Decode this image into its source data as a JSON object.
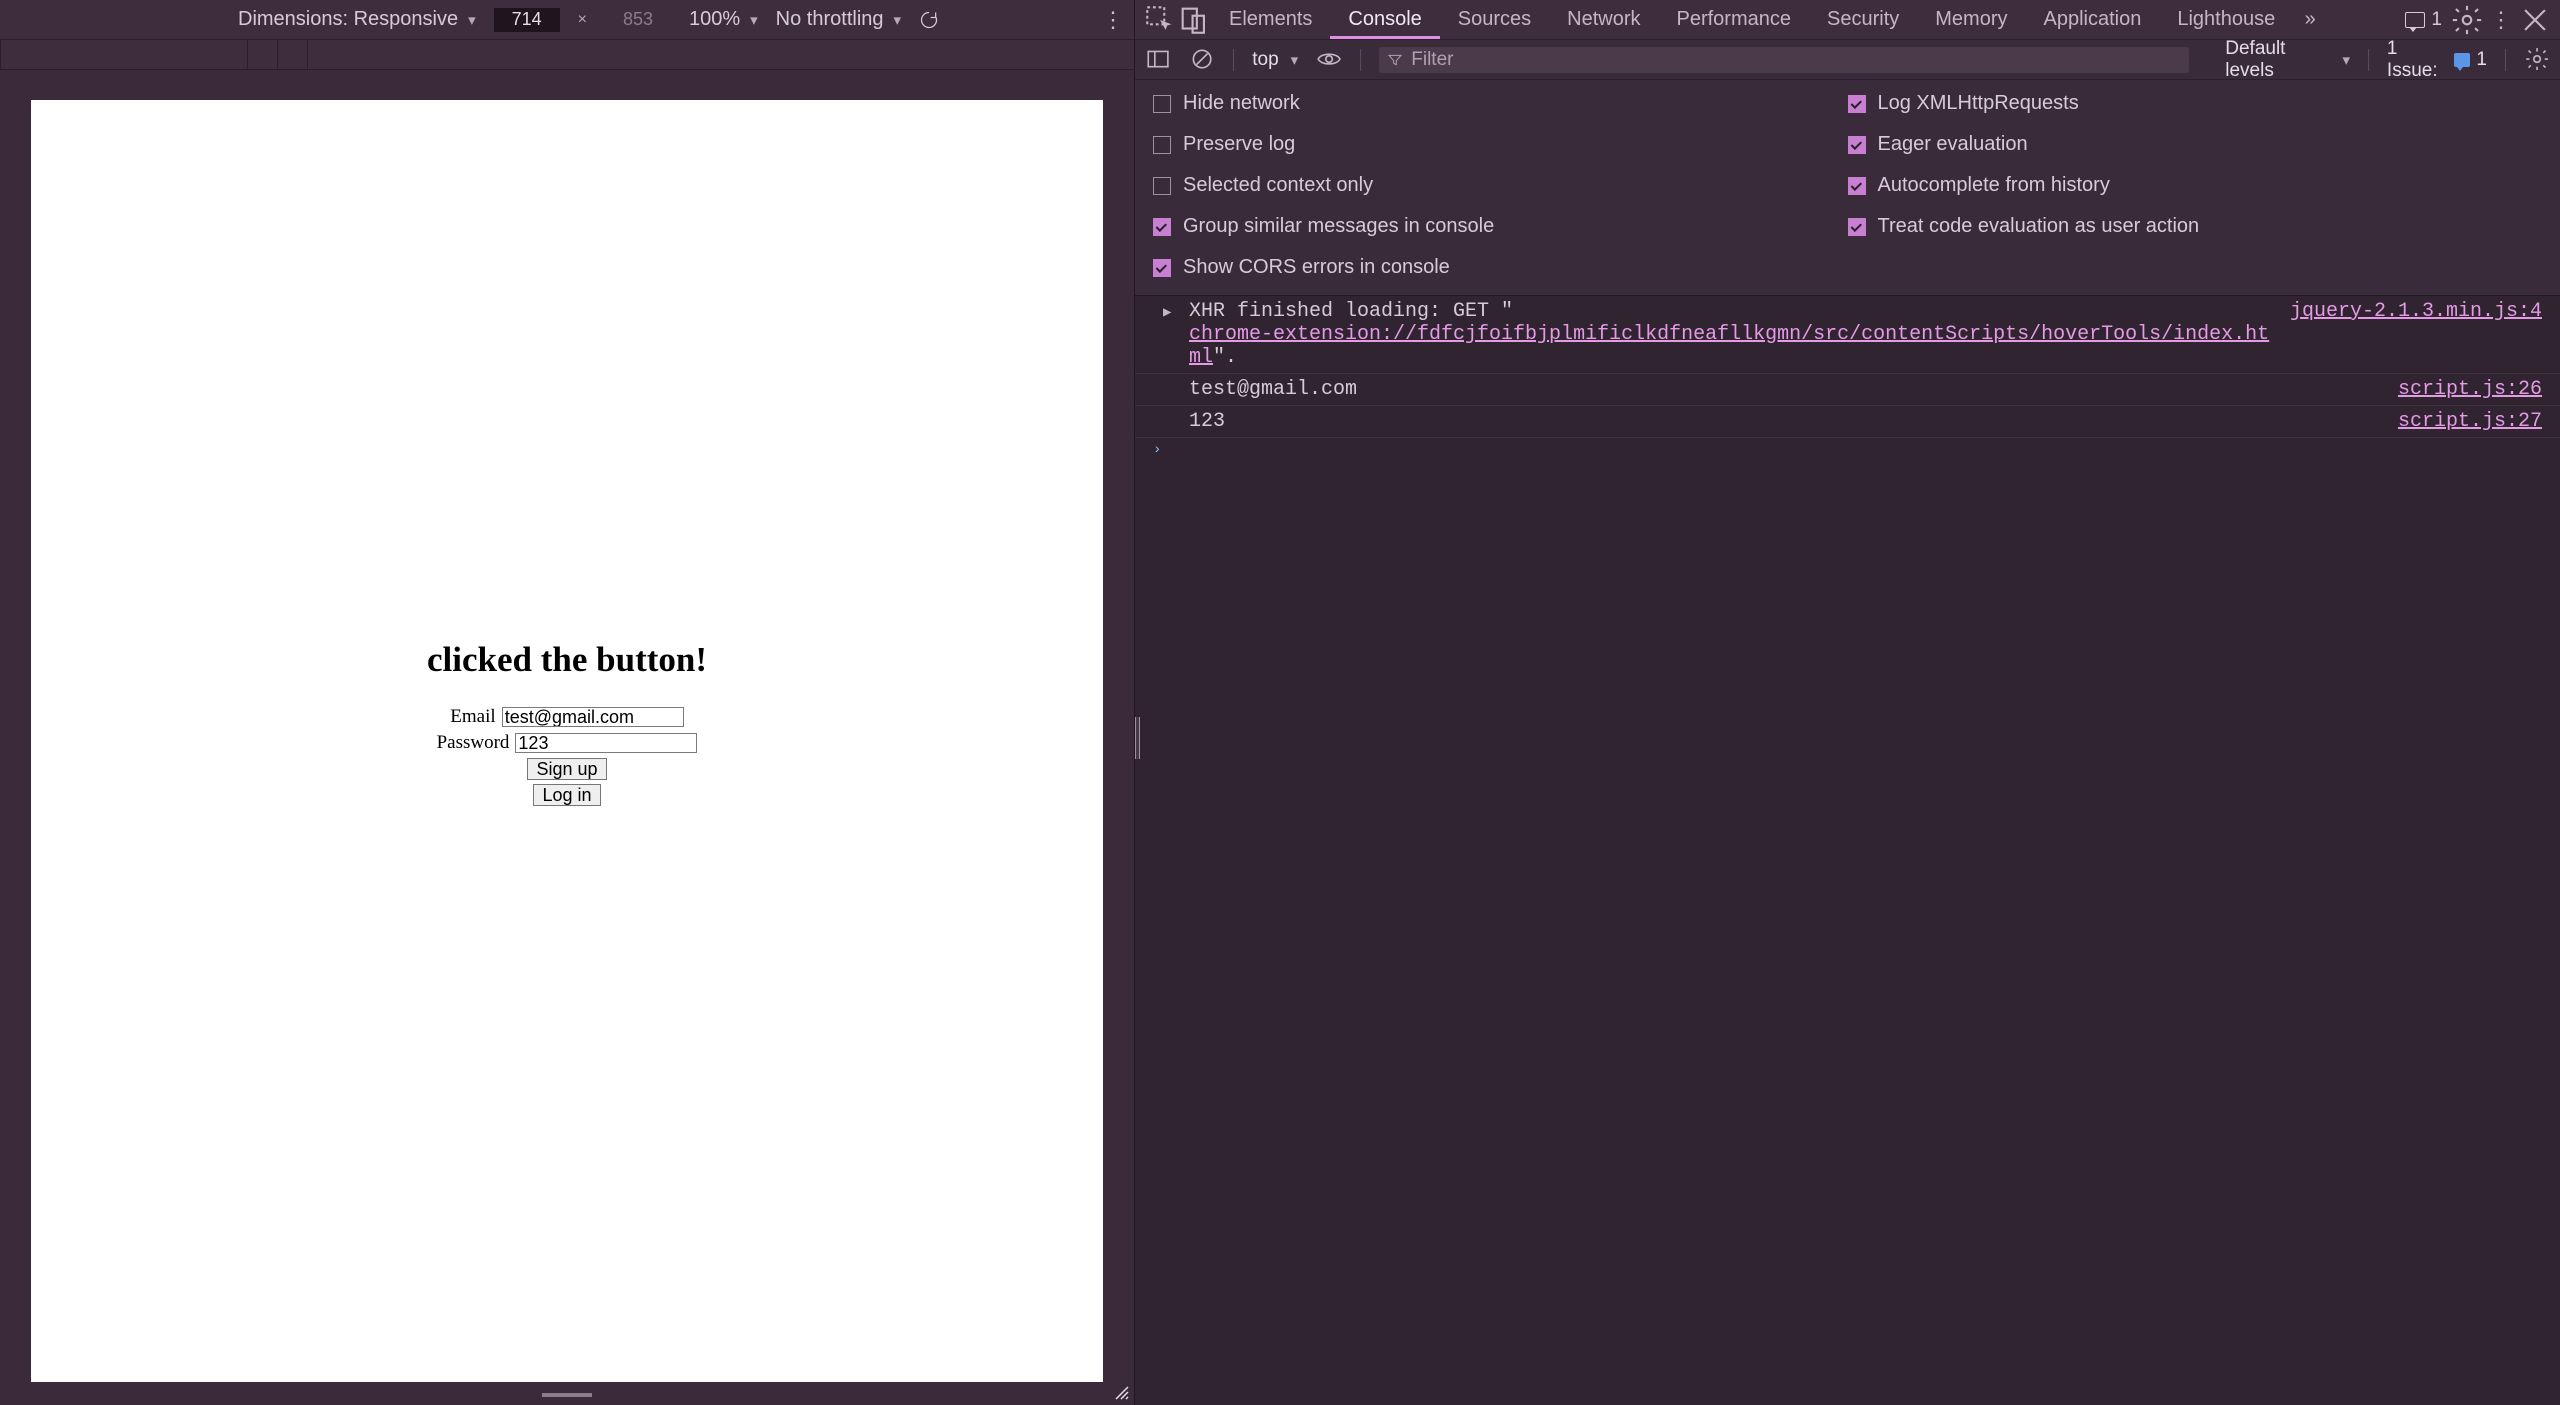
{
  "device_toolbar": {
    "dimensions_label": "Dimensions: Responsive",
    "width": "714",
    "height": "853",
    "zoom": "100%",
    "throttling": "No throttling"
  },
  "page": {
    "heading": "clicked the button!",
    "email_label": "Email",
    "email_value": "test@gmail.com",
    "password_label": "Password",
    "password_value": "123",
    "signup_label": "Sign up",
    "login_label": "Log in"
  },
  "devtools_tabs": {
    "elements": "Elements",
    "console": "Console",
    "sources": "Sources",
    "network": "Network",
    "performance": "Performance",
    "security": "Security",
    "memory": "Memory",
    "application": "Application",
    "lighthouse": "Lighthouse",
    "msg_count": "1"
  },
  "console_toolbar": {
    "context": "top",
    "filter_placeholder": "Filter",
    "levels": "Default levels",
    "issue_label": "1 Issue:",
    "issue_count": "1"
  },
  "settings": {
    "hide_network": "Hide network",
    "preserve_log": "Preserve log",
    "selected_context": "Selected context only",
    "group_similar": "Group similar messages in console",
    "show_cors": "Show CORS errors in console",
    "log_xhr": "Log XMLHttpRequests",
    "eager_eval": "Eager evaluation",
    "autocomplete": "Autocomplete from history",
    "treat_code_eval": "Treat code evaluation as user action"
  },
  "log": {
    "row1_prefix": "XHR finished loading: GET \"",
    "row1_link": "chrome-extension://fdfcjfoifbjplmificlkdfneafllkgmn/src/contentScripts/hoverTools/index.html",
    "row1_suffix": "\".",
    "row1_src": "jquery-2.1.3.min.js:4",
    "row2_msg": "test@gmail.com",
    "row2_src": "script.js:26",
    "row3_msg": "123",
    "row3_src": "script.js:27"
  }
}
